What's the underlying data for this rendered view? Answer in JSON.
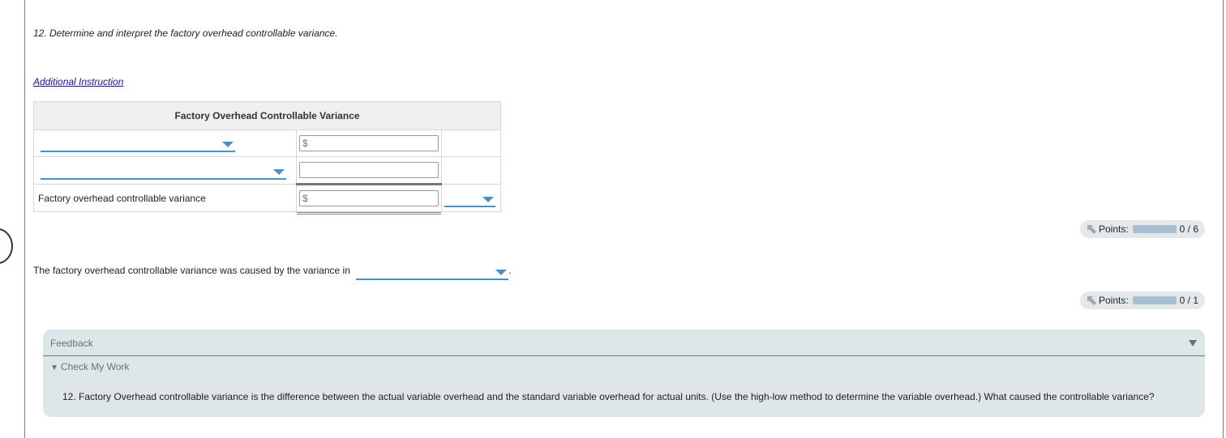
{
  "question": {
    "text": "12. Determine and interpret the factory overhead controllable variance.",
    "additional_instruction": "Additional Instruction"
  },
  "table": {
    "title": "Factory Overhead Controllable Variance",
    "rows": [
      {
        "label_dropdown": "",
        "amount_prefix": "$",
        "amount_value": ""
      },
      {
        "label_dropdown": "",
        "amount_prefix": "",
        "amount_value": ""
      },
      {
        "label": "Factory overhead controllable variance",
        "amount_prefix": "$",
        "amount_value": "",
        "type_dropdown": ""
      }
    ]
  },
  "points": [
    {
      "label": "Points:",
      "value": "0 / 6",
      "earned": 0,
      "possible": 6
    },
    {
      "label": "Points:",
      "value": "0 / 1",
      "earned": 0,
      "possible": 1
    }
  ],
  "interpretation": {
    "sentence": "The factory overhead controllable variance was caused by the variance in",
    "dropdown_value": "",
    "trailing": "."
  },
  "feedback": {
    "header": "Feedback",
    "check_my_work": "Check My Work",
    "text": "12. Factory Overhead controllable variance is the difference between the actual variable overhead and the standard variable overhead for actual units. (Use the high-low method to determine the variable overhead.) What caused the controllable variance?"
  },
  "colors": {
    "dropdown_accent": "#4a90c8",
    "feedback_bg": "#dfe6e9",
    "link": "#1a0dab"
  }
}
